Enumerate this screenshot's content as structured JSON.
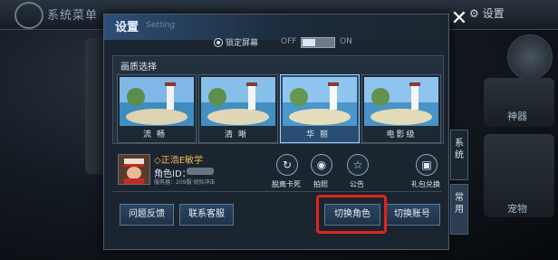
{
  "background": {
    "menu_title": "系统菜单",
    "top_right_settings": "设置",
    "right_label_1": "神器",
    "right_label_2": "宠物"
  },
  "dialog": {
    "title": "设置",
    "subtitle_en": "Setting",
    "close_label": "✕"
  },
  "lock_screen": {
    "label": "锁定屏幕",
    "off_label": "OFF",
    "on_label": "ON",
    "enabled": false
  },
  "quality": {
    "title": "画质选择",
    "options": [
      {
        "label": "流畅",
        "selected": false
      },
      {
        "label": "清晰",
        "selected": false
      },
      {
        "label": "华丽",
        "selected": true
      },
      {
        "label": "电影级",
        "selected": false
      }
    ]
  },
  "side_tabs": {
    "system": "系统",
    "common": "常用"
  },
  "profile": {
    "name": "◇正浩E敏学",
    "id_label": "角色ID：",
    "server": "服务器：209服·锐际冲击"
  },
  "actions": [
    {
      "label": "脱离卡死",
      "icon": "rescue-icon"
    },
    {
      "label": "拍照",
      "icon": "camera-icon"
    },
    {
      "label": "公告",
      "icon": "star-icon"
    },
    {
      "label": "礼包兑换",
      "icon": "gift-icon"
    }
  ],
  "buttons": {
    "feedback": "问题反馈",
    "support": "联系客服",
    "switch_role": "切换角色",
    "switch_account": "切换账号"
  }
}
